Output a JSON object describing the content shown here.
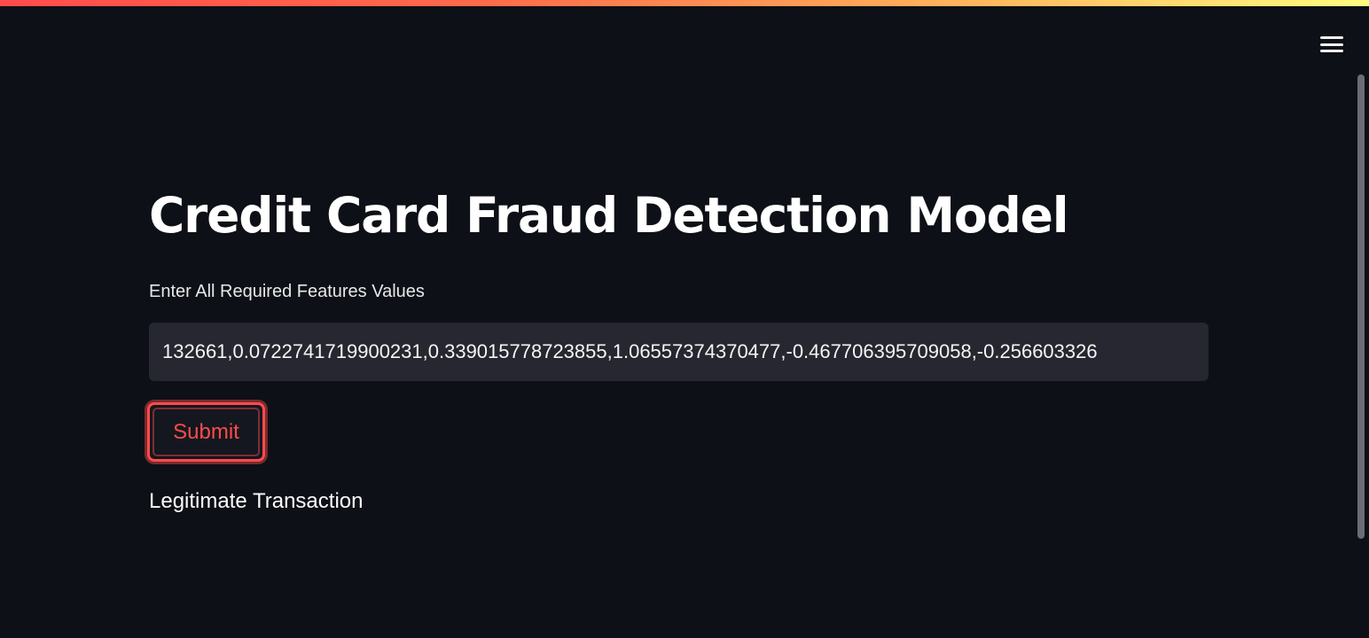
{
  "header": {
    "menu_icon": "hamburger-menu-icon"
  },
  "main": {
    "title": "Credit Card Fraud Detection Model",
    "input": {
      "label": "Enter All Required Features Values",
      "value": "132661,0.0722741719900231,0.339015778723855,1.06557374370477,-0.467706395709058,-0.256603326"
    },
    "submit_label": "Submit",
    "result": "Legitimate Transaction"
  },
  "colors": {
    "background": "#0d1016",
    "input_background": "#262730",
    "accent": "#ff4b4b",
    "text": "#fafafa"
  }
}
